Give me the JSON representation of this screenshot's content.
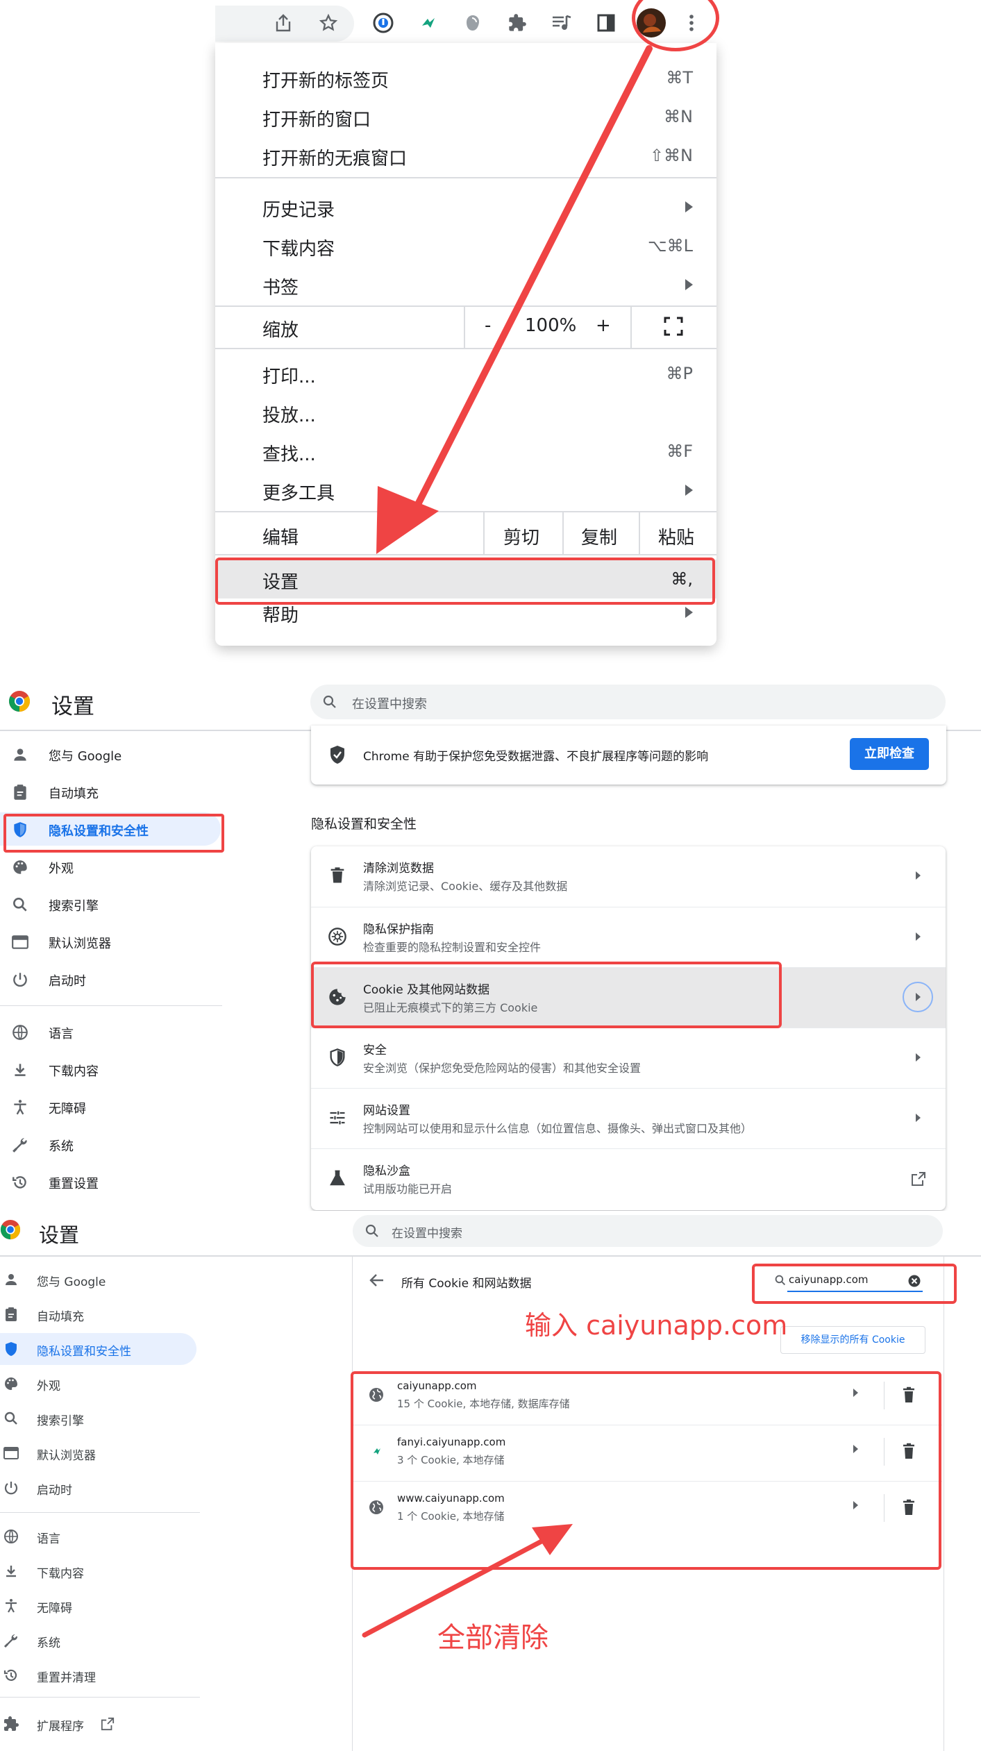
{
  "menu": {
    "items_group1": [
      {
        "label": "打开新的标签页",
        "shortcut": "⌘T"
      },
      {
        "label": "打开新的窗口",
        "shortcut": "⌘N"
      },
      {
        "label": "打开新的无痕窗口",
        "shortcut": "⇧⌘N"
      }
    ],
    "items_group2": [
      {
        "label": "历史记录",
        "submenu": true
      },
      {
        "label": "下载内容",
        "shortcut": "⌥⌘L"
      },
      {
        "label": "书签",
        "submenu": true
      }
    ],
    "zoom": {
      "label": "缩放",
      "minus": "-",
      "value": "100%",
      "plus": "+"
    },
    "items_group3": [
      {
        "label": "打印...",
        "shortcut": "⌘P"
      },
      {
        "label": "投放..."
      },
      {
        "label": "查找...",
        "shortcut": "⌘F"
      },
      {
        "label": "更多工具",
        "submenu": true
      }
    ],
    "edit": {
      "label": "编辑",
      "cut": "剪切",
      "copy": "复制",
      "paste": "粘贴"
    },
    "settings": {
      "label": "设置",
      "shortcut": "⌘,"
    },
    "help": {
      "label": "帮助",
      "submenu": true
    }
  },
  "settings_page": {
    "title": "设置",
    "search_placeholder": "在设置中搜索",
    "nav": [
      "您与 Google",
      "自动填充",
      "隐私设置和安全性",
      "外观",
      "搜索引擎",
      "默认浏览器",
      "启动时",
      "语言",
      "下载内容",
      "无障碍",
      "系统",
      "重置设置"
    ],
    "safety_text": "Chrome 有助于保护您免受数据泄露、不良扩展程序等问题的影响",
    "safety_button": "立即检查",
    "section_title": "隐私设置和安全性",
    "rows": [
      {
        "title": "清除浏览数据",
        "subtitle": "清除浏览记录、Cookie、缓存及其他数据"
      },
      {
        "title": "隐私保护指南",
        "subtitle": "检查重要的隐私控制设置和安全控件"
      },
      {
        "title": "Cookie 及其他网站数据",
        "subtitle": "已阻止无痕模式下的第三方 Cookie"
      },
      {
        "title": "安全",
        "subtitle": "安全浏览（保护您免受危险网站的侵害）和其他安全设置"
      },
      {
        "title": "网站设置",
        "subtitle": "控制网站可以使用和显示什么信息（如位置信息、摄像头、弹出式窗口及其他）"
      },
      {
        "title": "隐私沙盒",
        "subtitle": "试用版功能已开启"
      }
    ]
  },
  "cookies_page": {
    "title": "设置",
    "search_placeholder": "在设置中搜索",
    "nav": [
      "您与 Google",
      "自动填充",
      "隐私设置和安全性",
      "外观",
      "搜索引擎",
      "默认浏览器",
      "启动时",
      "语言",
      "下载内容",
      "无障碍",
      "系统",
      "重置并清理",
      "扩展程序"
    ],
    "header": "所有 Cookie 和网站数据",
    "filter_value": "caiyunapp.com",
    "remove_all": "移除显示的所有 Cookie",
    "sites": [
      {
        "name": "caiyunapp.com",
        "detail": "15 个 Cookie, 本地存储, 数据库存储"
      },
      {
        "name": "fanyi.caiyunapp.com",
        "detail": "3 个 Cookie, 本地存储"
      },
      {
        "name": "www.caiyunapp.com",
        "detail": "1 个 Cookie, 本地存储"
      }
    ]
  },
  "annotations": {
    "input_hint": "输入 caiyunapp.com",
    "clear_all": "全部清除"
  },
  "colors": {
    "accent": "#1a73e8",
    "annotation": "#ef4444",
    "selected_bg": "#e8f0fe"
  }
}
